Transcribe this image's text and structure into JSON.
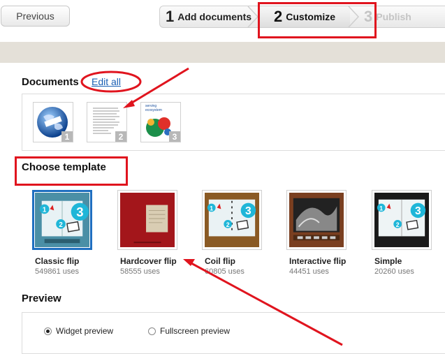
{
  "topbar": {
    "previous_label": "Previous",
    "steps": [
      {
        "num": "1",
        "label": "Add documents"
      },
      {
        "num": "2",
        "label": "Customize"
      },
      {
        "num": "3",
        "label": "Publish"
      }
    ]
  },
  "documents": {
    "title": "Documents",
    "edit_all": "Edit all",
    "items": [
      {
        "num": "1"
      },
      {
        "num": "2"
      },
      {
        "num": "3",
        "caption": "serving ecosystem"
      }
    ]
  },
  "templates": {
    "title": "Choose template",
    "items": [
      {
        "name": "Classic flip",
        "uses": "549861 uses",
        "selected": true
      },
      {
        "name": "Hardcover flip",
        "uses": "58555 uses",
        "selected": false
      },
      {
        "name": "Coil flip",
        "uses": "60805 uses",
        "selected": false
      },
      {
        "name": "Interactive flip",
        "uses": "44451 uses",
        "selected": false
      },
      {
        "name": "Simple",
        "uses": "20260 uses",
        "selected": false
      }
    ]
  },
  "preview": {
    "title": "Preview",
    "options": [
      {
        "label": "Widget preview",
        "checked": true
      },
      {
        "label": "Fullscreen preview",
        "checked": false
      }
    ]
  },
  "colors": {
    "annotation_red": "#e0141e",
    "selected_blue": "#1f6fc0",
    "link_blue": "#1a5fb4",
    "band": "#e4e0d8",
    "cyan_badge": "#1fb6d8"
  }
}
